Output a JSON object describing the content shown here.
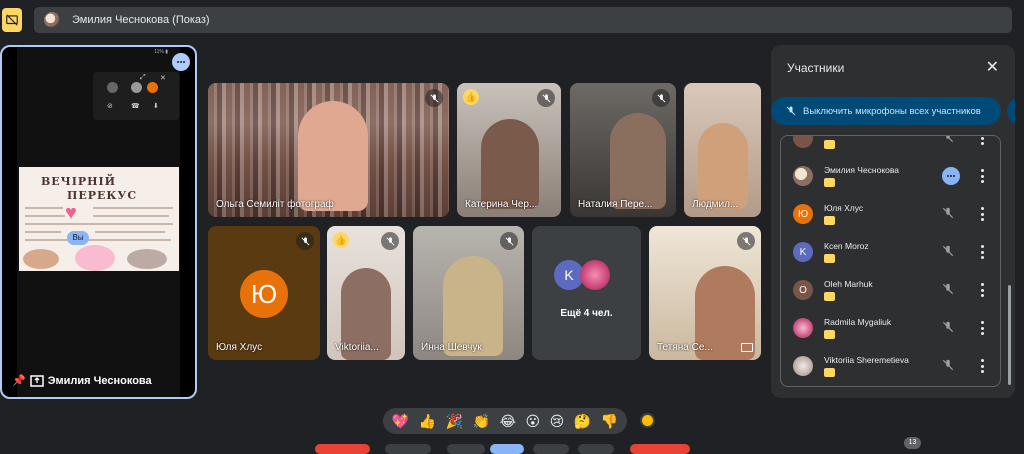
{
  "header": {
    "presenting_title": "Эмилия Чеснокова (Показ)",
    "present_icon": "present-off-icon"
  },
  "stage": {
    "presenter_name": "Эмилия Чеснокова",
    "battery": "11% ▮",
    "slide_title_1": "ВЕЧІРНІЙ",
    "slide_title_2": "ПЕРЕКУС",
    "self_label": "Вы",
    "pin_icon": "pin-icon",
    "present_icon": "presenting-icon"
  },
  "tiles": [
    {
      "name": "Ольга Семиліт фотограф",
      "muted": true
    },
    {
      "name": "Катерина Чер...",
      "muted": true,
      "hand": true
    },
    {
      "name": "Наталия Пере...",
      "muted": true
    },
    {
      "name": "Людмил...",
      "muted": false
    },
    {
      "name": "Юля Хлус",
      "muted": true,
      "letter": "Ю"
    },
    {
      "name": "Viktoriia...",
      "muted": true,
      "hand": true
    },
    {
      "name": "Инна Шевчук",
      "muted": true
    },
    {
      "name": "Тетяна Се...",
      "muted": true
    }
  ],
  "more_tile": {
    "label": "Ещё 4 чел.",
    "letter": "K"
  },
  "panel": {
    "title": "Участники",
    "mute_all_label": "Выключить микрофоны всех участников",
    "participants": [
      {
        "name": "",
        "avatar": "photo",
        "color": "#795548"
      },
      {
        "name": "Эмилия Чеснокова",
        "avatar": "photo",
        "color": "#a1887f",
        "presenting": true
      },
      {
        "name": "Юля Хлус",
        "avatar": "Ю",
        "color": "#e8710a"
      },
      {
        "name": "Ксеn Moroz",
        "avatar": "K",
        "color": "#5c6bc0"
      },
      {
        "name": "Oleh Marhuk",
        "avatar": "O",
        "color": "#795548"
      },
      {
        "name": "Radmila Mygaliuk",
        "avatar": "photo",
        "color": "#f48fb1"
      },
      {
        "name": "Viktoriia Sheremetieva",
        "avatar": "photo",
        "color": "#d7ccc8"
      }
    ]
  },
  "reactions": [
    "💖",
    "👍",
    "🎉",
    "👏",
    "😂",
    "😮",
    "😢",
    "🤔",
    "👎"
  ],
  "people_count": "13"
}
